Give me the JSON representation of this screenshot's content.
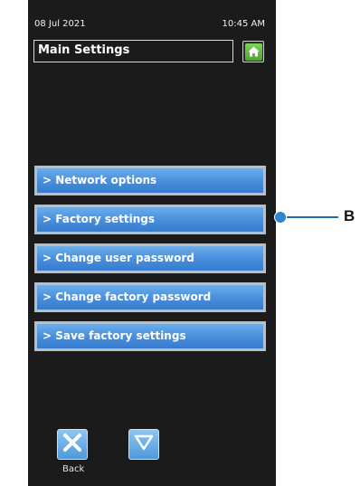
{
  "status_bar": {
    "date": "08 Jul 2021",
    "time": "10:45 AM"
  },
  "header": {
    "title": "Main Settings",
    "home_icon": "home-icon"
  },
  "menu": {
    "items": [
      {
        "label": "> Network options"
      },
      {
        "label": "> Factory settings"
      },
      {
        "label": "> Change user password"
      },
      {
        "label": "> Change factory password"
      },
      {
        "label": "> Save factory settings"
      }
    ]
  },
  "annotation": {
    "callout_label": "B",
    "color": "#1c6fb5"
  },
  "footer": {
    "back_label": "Back",
    "back_icon": "close-x-icon",
    "down_icon": "down-arrow-icon"
  },
  "colors": {
    "screen_bg": "#1b1b1b",
    "button_blue": "#4a90dd",
    "home_green": "#5db63a"
  }
}
